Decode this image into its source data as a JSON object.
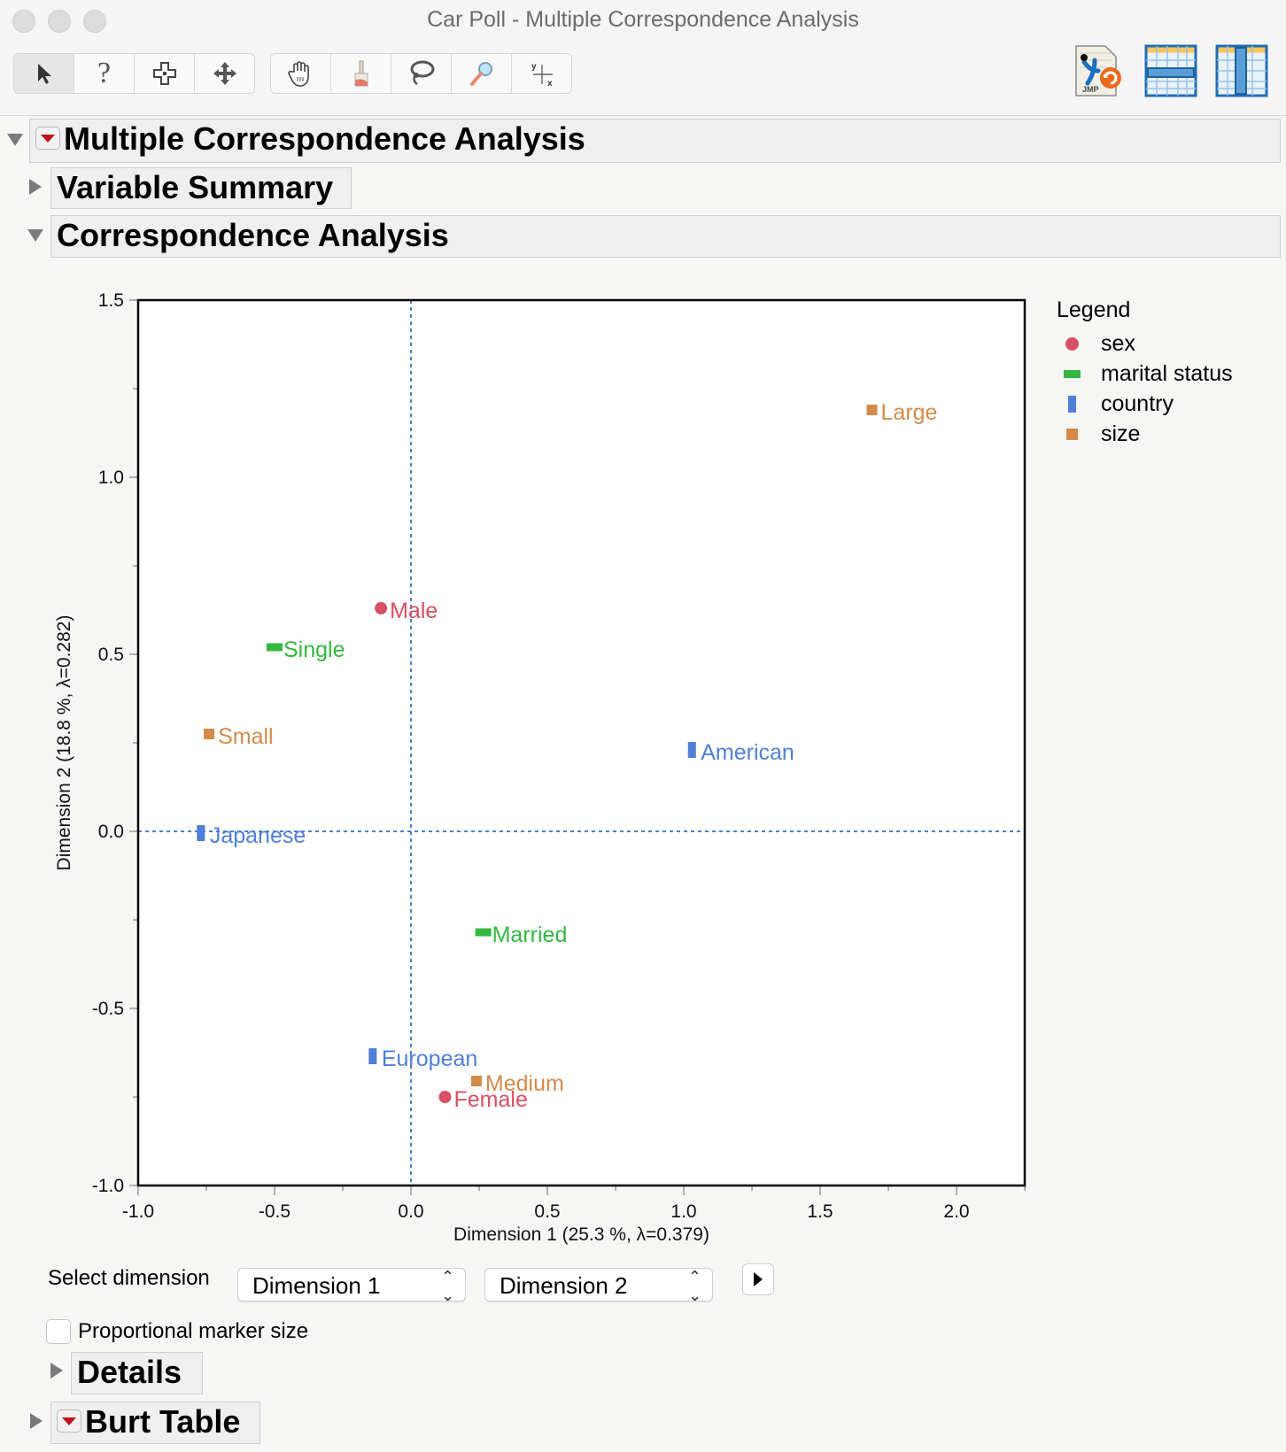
{
  "window": {
    "title": "Car Poll - Multiple Correspondence Analysis"
  },
  "toolbar": {
    "left_tools": [
      {
        "name": "arrow-tool-icon",
        "glyph": "➤",
        "active": true
      },
      {
        "name": "help-tool-icon",
        "glyph": "?"
      },
      {
        "name": "selection-tool-icon",
        "glyph": "✥"
      },
      {
        "name": "scroller-tool-icon",
        "glyph": "✣"
      }
    ],
    "right_tools": [
      {
        "name": "grabber-hand-icon",
        "glyph": "✋"
      },
      {
        "name": "brush-tool-icon",
        "glyph": "🖌"
      },
      {
        "name": "lasso-tool-icon",
        "glyph": "➰"
      },
      {
        "name": "magnifier-tool-icon",
        "glyph": "🔍"
      },
      {
        "name": "crosshair-tool-icon",
        "glyph": "⌖"
      }
    ],
    "jmp_badge": "JMP"
  },
  "outline": {
    "main_title": "Multiple Correspondence Analysis",
    "variable_summary": "Variable Summary",
    "correspondence_analysis": "Correspondence Analysis",
    "details": "Details",
    "burt_table": "Burt Table"
  },
  "controls": {
    "select_dimension_label": "Select dimension",
    "dim_x_selected": "Dimension 1",
    "dim_y_selected": "Dimension 2",
    "proportional_marker_label": "Proportional marker size",
    "proportional_marker_checked": false
  },
  "chart_data": {
    "type": "scatter",
    "title": "",
    "xlabel": "Dimension 1  (25.3 %, λ=0.379)",
    "ylabel": "Dimension 2  (18.8 %, λ=0.282)",
    "xlim": [
      -1.0,
      2.25
    ],
    "ylim": [
      -1.0,
      1.5
    ],
    "xticks": [
      -1.0,
      -0.5,
      0.0,
      0.5,
      1.0,
      1.5,
      2.0
    ],
    "xtick_labels": [
      "-1.0",
      "-0.5",
      "0.0",
      "0.5",
      "1.0",
      "1.5",
      "2.0"
    ],
    "yticks": [
      -1.0,
      -0.5,
      0.0,
      0.5,
      1.0,
      1.5
    ],
    "ytick_labels": [
      "-1.0",
      "-0.5",
      "0.0",
      "0.5",
      "1.0",
      "1.5"
    ],
    "reference_lines": {
      "x": 0.0,
      "y": 0.0,
      "style": "dotted",
      "color": "#4a7fcf"
    },
    "grid": false,
    "legend": {
      "title": "Legend",
      "placement": "right",
      "entries": [
        {
          "name": "sex",
          "marker": "circle",
          "color": "#d94f63"
        },
        {
          "name": "marital status",
          "marker": "hbar",
          "color": "#34b83f"
        },
        {
          "name": "country",
          "marker": "vbar",
          "color": "#4f7fd8"
        },
        {
          "name": "size",
          "marker": "square",
          "color": "#d48a4a"
        }
      ]
    },
    "series": [
      {
        "name": "sex",
        "points": [
          {
            "label": "Male",
            "x": -0.11,
            "y": 0.63
          },
          {
            "label": "Female",
            "x": 0.125,
            "y": -0.75
          }
        ]
      },
      {
        "name": "marital status",
        "points": [
          {
            "label": "Single",
            "x": -0.5,
            "y": 0.52
          },
          {
            "label": "Married",
            "x": 0.265,
            "y": -0.285
          }
        ]
      },
      {
        "name": "country",
        "points": [
          {
            "label": "Japanese",
            "x": -0.77,
            "y": -0.005
          },
          {
            "label": "American",
            "x": 1.03,
            "y": 0.23
          },
          {
            "label": "European",
            "x": -0.14,
            "y": -0.635
          }
        ]
      },
      {
        "name": "size",
        "points": [
          {
            "label": "Large",
            "x": 1.69,
            "y": 1.19
          },
          {
            "label": "Small",
            "x": -0.74,
            "y": 0.275
          },
          {
            "label": "Medium",
            "x": 0.24,
            "y": -0.705
          }
        ]
      }
    ]
  }
}
